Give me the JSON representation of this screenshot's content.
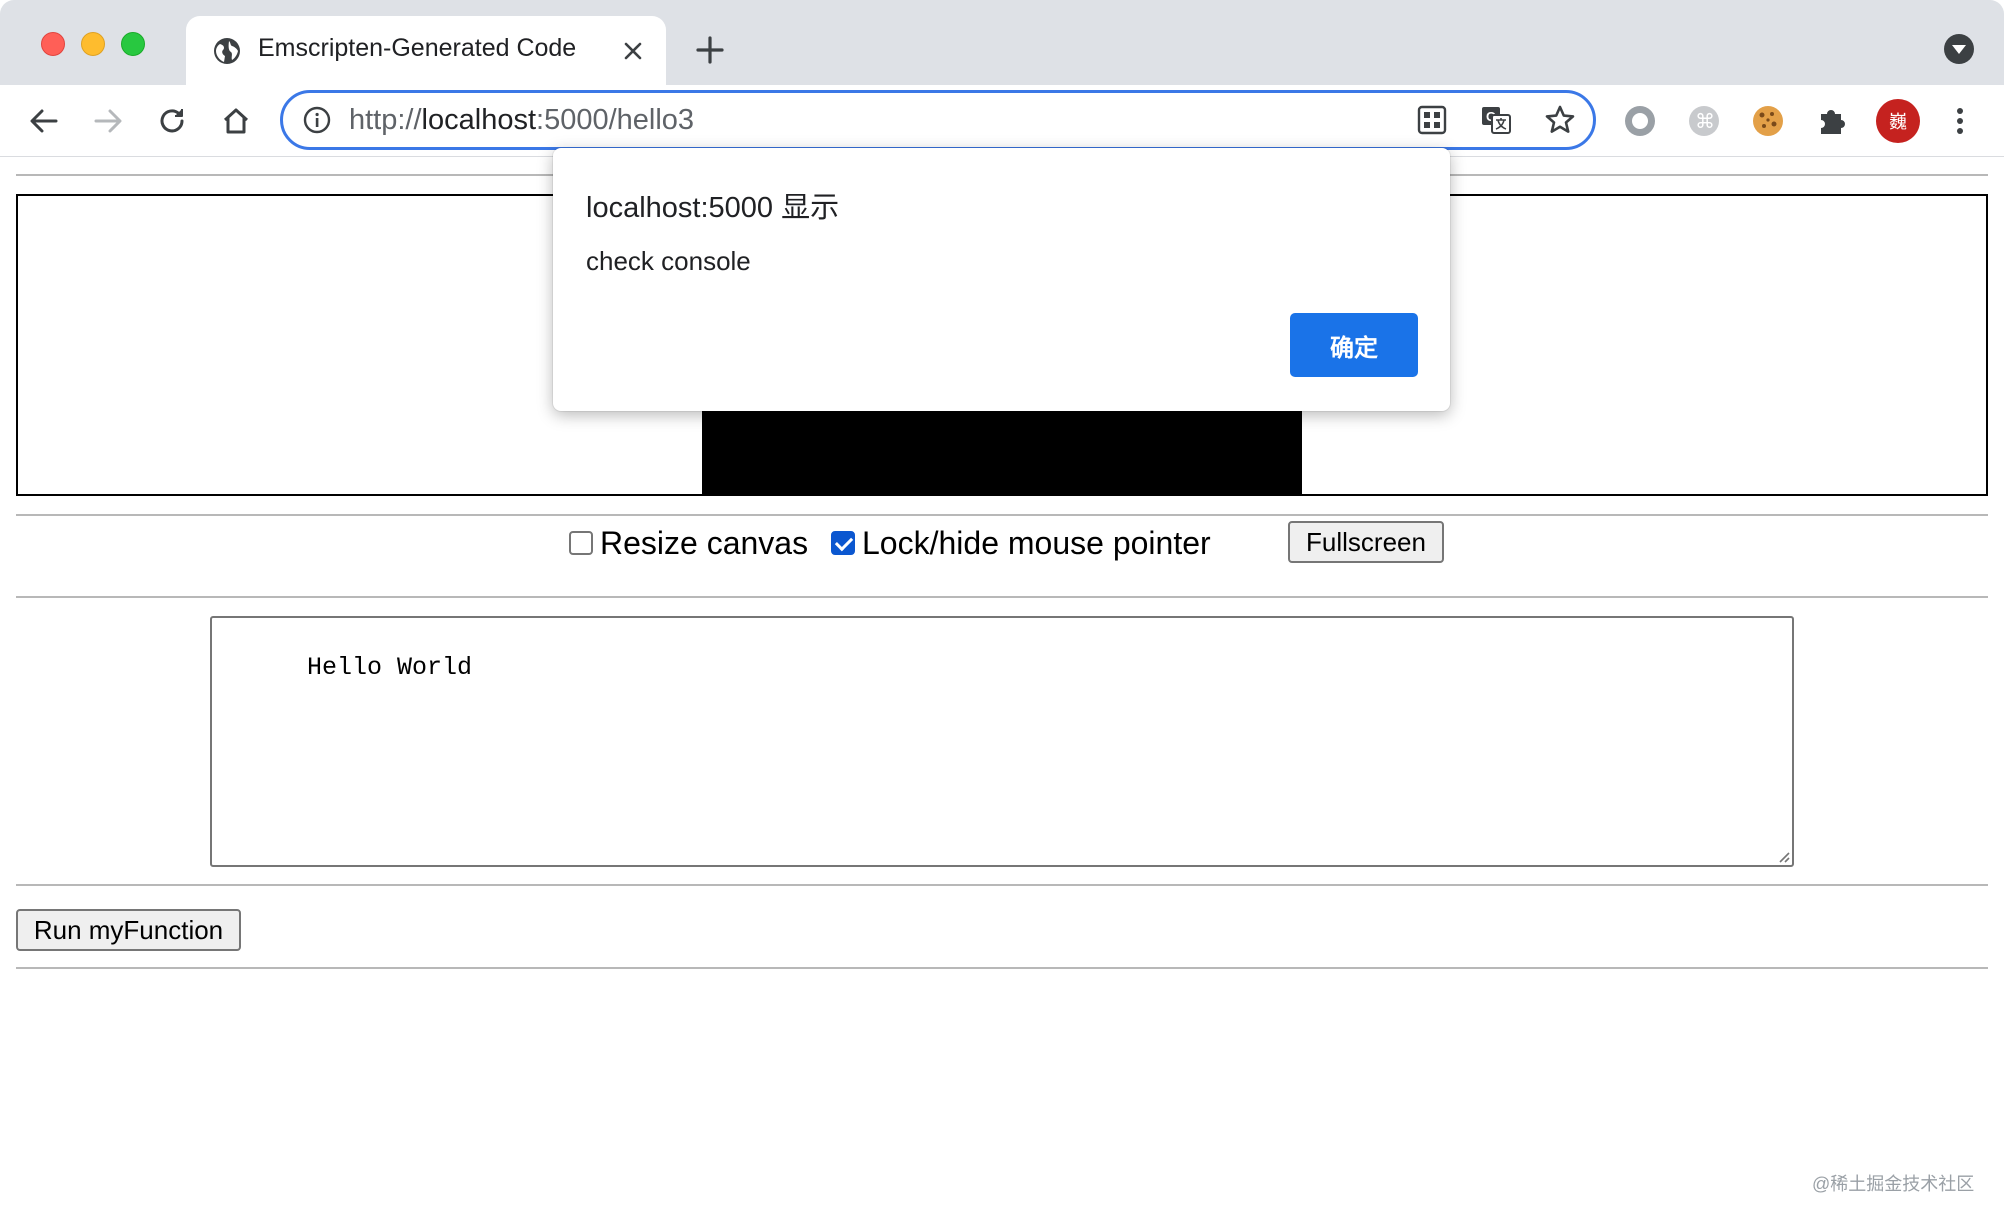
{
  "browser": {
    "tab": {
      "title": "Emscripten-Generated Code",
      "favicon": "globe-icon"
    },
    "address_bar": {
      "scheme": "http://",
      "host": "localhost",
      "rest": ":5000/hello3"
    },
    "profile_avatar_text": "巍",
    "colors": {
      "accent": "#1a73e8",
      "omnibox_focus": "#3b78e7",
      "avatar": "#c5221f"
    }
  },
  "page": {
    "controls": {
      "resize_canvas": {
        "label": "Resize canvas",
        "checked": false
      },
      "lock_pointer": {
        "label": "Lock/hide mouse pointer",
        "checked": true
      },
      "fullscreen_label": "Fullscreen"
    },
    "output_text": "Hello World",
    "run_button_label": "Run myFunction",
    "watermark": "@稀土掘金技术社区"
  },
  "dialog": {
    "title": "localhost:5000 显示",
    "message": "check console",
    "ok_label": "确定"
  }
}
